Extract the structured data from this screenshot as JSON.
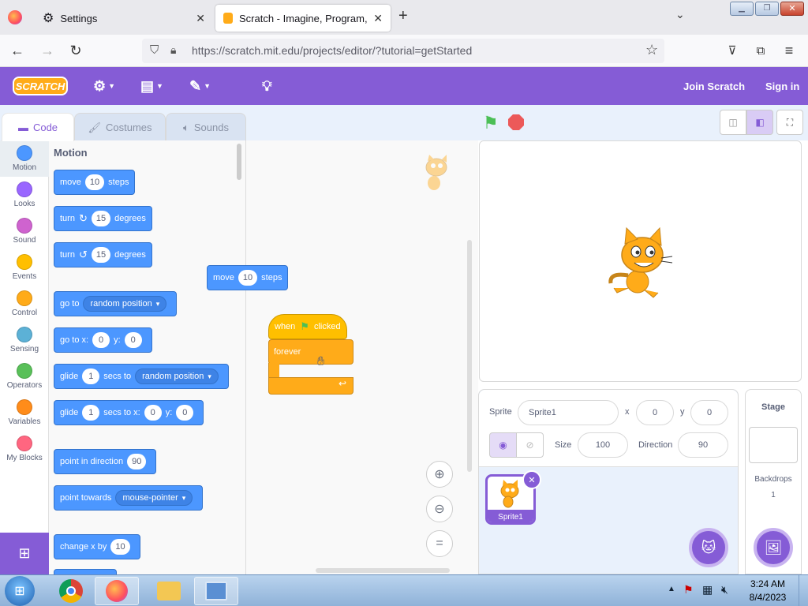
{
  "browser": {
    "tabs": [
      {
        "label": "Settings"
      },
      {
        "label": "Scratch - Imagine, Program, Sh"
      }
    ],
    "url": "https://scratch.mit.edu/projects/editor/?tutorial=getStarted",
    "url_domain": "scratch.mit.edu"
  },
  "menubar": {
    "logo": "SCRATCH",
    "join": "Join Scratch",
    "signin": "Sign in"
  },
  "editor_tabs": {
    "code": "Code",
    "costumes": "Costumes",
    "sounds": "Sounds"
  },
  "categories": [
    {
      "label": "Motion",
      "color": "#4c97ff"
    },
    {
      "label": "Looks",
      "color": "#9966ff"
    },
    {
      "label": "Sound",
      "color": "#cf63cf"
    },
    {
      "label": "Events",
      "color": "#ffbf00"
    },
    {
      "label": "Control",
      "color": "#ffab19"
    },
    {
      "label": "Sensing",
      "color": "#5cb1d6"
    },
    {
      "label": "Operators",
      "color": "#59c059"
    },
    {
      "label": "Variables",
      "color": "#ff8c1a"
    },
    {
      "label": "My Blocks",
      "color": "#ff6680"
    }
  ],
  "palette": {
    "heading": "Motion",
    "move": {
      "a": "move",
      "n": "10",
      "b": "steps"
    },
    "turn_cw": {
      "a": "turn",
      "n": "15",
      "b": "degrees"
    },
    "turn_ccw": {
      "a": "turn",
      "n": "15",
      "b": "degrees"
    },
    "goto": {
      "a": "go to",
      "dd": "random position"
    },
    "gotoxy": {
      "a": "go to x:",
      "x": "0",
      "b": "y:",
      "y": "0"
    },
    "glide1": {
      "a": "glide",
      "n": "1",
      "b": "secs to",
      "dd": "random position"
    },
    "glide2": {
      "a": "glide",
      "n": "1",
      "b": "secs to x:",
      "x": "0",
      "c": "y:",
      "y": "0"
    },
    "pointdir": {
      "a": "point in direction",
      "n": "90"
    },
    "pointtow": {
      "a": "point towards",
      "dd": "mouse-pointer"
    },
    "changex": {
      "a": "change x by",
      "n": "10"
    }
  },
  "script": {
    "move": {
      "a": "move",
      "n": "10",
      "b": "steps"
    },
    "when": {
      "a": "when",
      "b": "clicked"
    },
    "forever": "forever"
  },
  "sprite_info": {
    "sprite_label": "Sprite",
    "sprite_name": "Sprite1",
    "x_label": "x",
    "x": "0",
    "y_label": "y",
    "y": "0",
    "size_label": "Size",
    "size": "100",
    "direction_label": "Direction",
    "direction": "90"
  },
  "sprite_tile": "Sprite1",
  "stage_panel": {
    "title": "Stage",
    "backdrops_label": "Backdrops",
    "backdrops_count": "1"
  },
  "taskbar": {
    "time": "3:24 AM",
    "date": "8/4/2023"
  }
}
